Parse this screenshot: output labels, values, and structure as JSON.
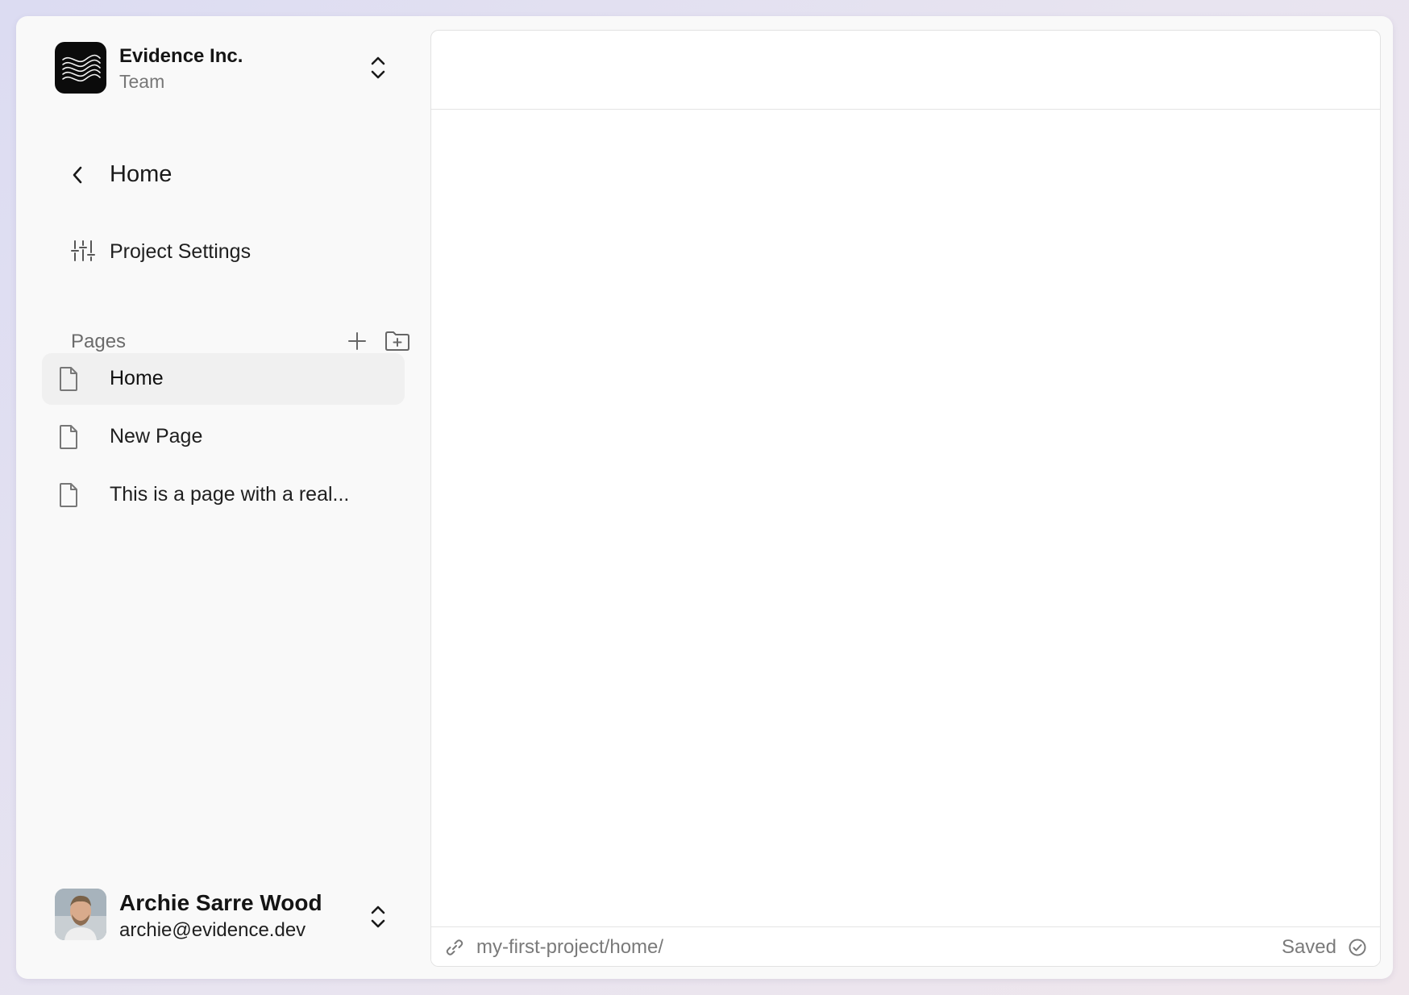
{
  "org": {
    "name": "Evidence Inc.",
    "plan": "Team",
    "logo_icon": "evidence-wave-logo"
  },
  "nav": {
    "back_label": "Home",
    "back_icon": "chevron-left-icon",
    "settings_label": "Project Settings",
    "settings_icon": "sliders-icon"
  },
  "pages": {
    "title": "Pages",
    "add_page_icon": "plus-icon",
    "add_folder_icon": "folder-plus-icon",
    "items": [
      {
        "label": "Home",
        "active": true
      },
      {
        "label": "New Page",
        "active": false
      },
      {
        "label": "This is a page with a real...",
        "active": false
      }
    ]
  },
  "user": {
    "name": "Archie Sarre Wood",
    "email": "archie@evidence.dev"
  },
  "editor": {
    "path": "my-first-project/home/",
    "status": "Saved",
    "status_icon": "check-circle-icon",
    "link_icon": "link-icon"
  },
  "colors": {
    "sidebar_bg": "#f9f9f9",
    "active_item_bg": "#f0f0f0",
    "logo_bg": "#0b0b0b",
    "muted_text": "#777777"
  }
}
